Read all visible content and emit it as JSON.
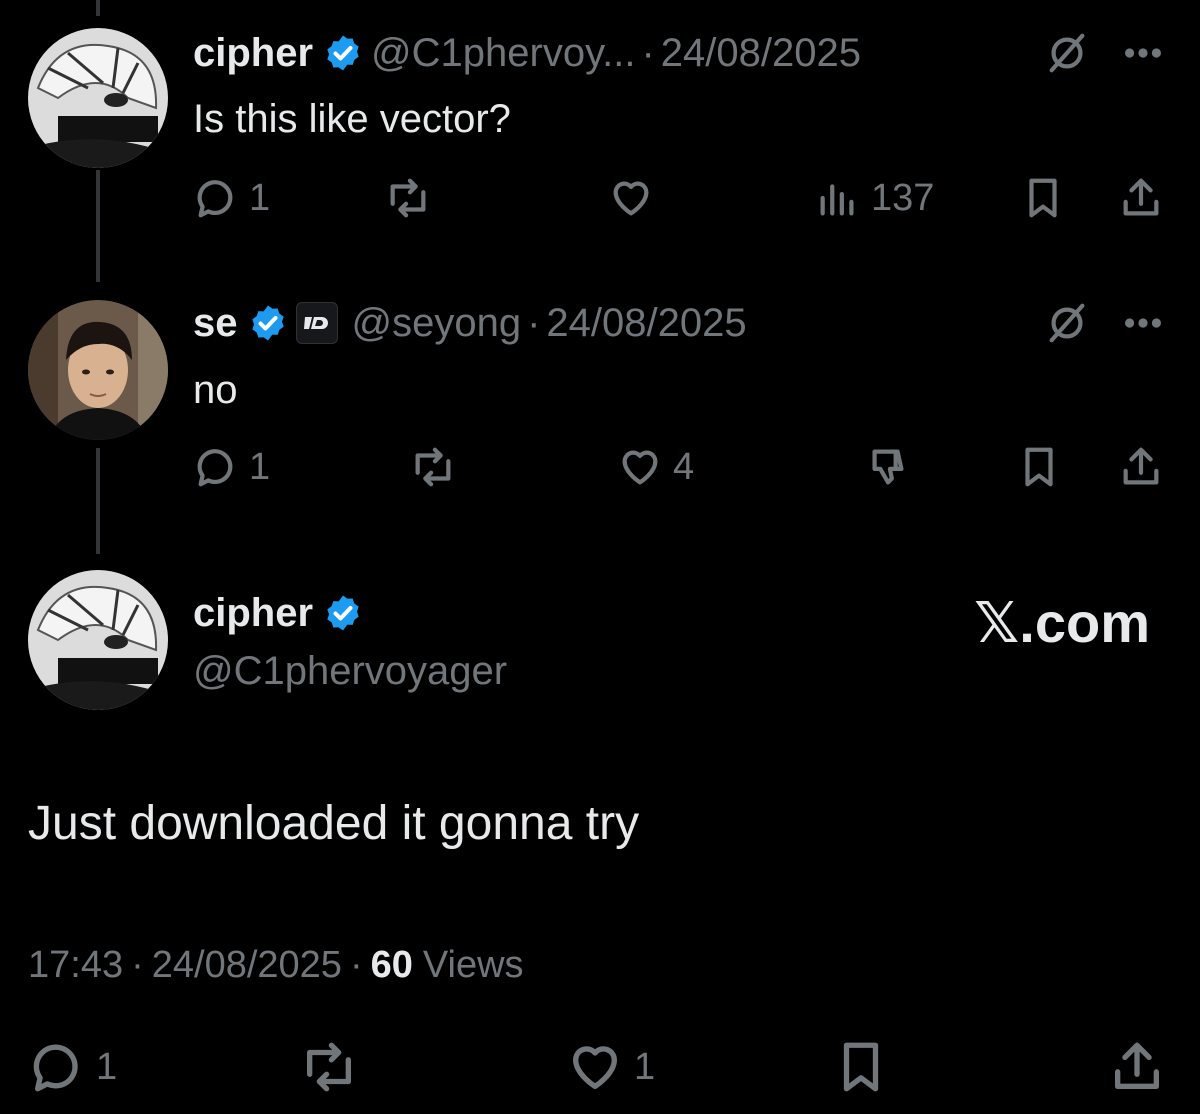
{
  "reply1": {
    "display_name": "cipher",
    "handle": "@C1phervoy...",
    "separator": "·",
    "date": "24/08/2025",
    "text": "Is this like vector?",
    "reply_count": "1",
    "view_count": "137"
  },
  "reply2": {
    "display_name": "se",
    "handle": "@seyong",
    "separator": "·",
    "date": "24/08/2025",
    "text": "no",
    "reply_count": "1",
    "like_count": "4"
  },
  "main_post": {
    "display_name": "cipher",
    "handle": "@C1phervoyager",
    "brand": "𝕏.com",
    "text": "Just downloaded it gonna try",
    "time": "17:43",
    "separator": "·",
    "date": "24/08/2025",
    "views_count": "60",
    "views_label": "Views",
    "reply_count": "1",
    "like_count": "1"
  },
  "colors": {
    "background": "#000000",
    "text": "#e7e9ea",
    "muted": "#71767b",
    "verified": "#1d9bf0"
  },
  "icons": [
    "reply-icon",
    "repost-icon",
    "like-icon",
    "views-icon",
    "bookmark-icon",
    "share-icon",
    "grok-icon",
    "more-icon",
    "dislike-icon",
    "verified-badge-icon"
  ]
}
